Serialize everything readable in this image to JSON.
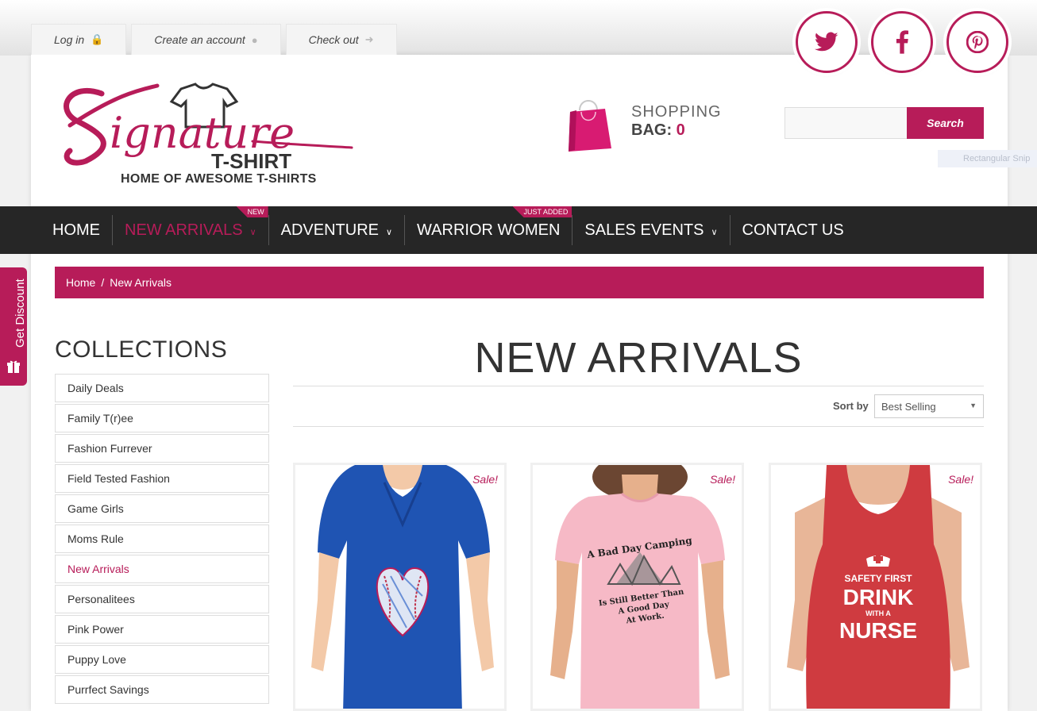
{
  "topbar": {
    "login": "Log in",
    "create_account": "Create an account",
    "checkout": "Check out"
  },
  "social": [
    "twitter-icon",
    "facebook-icon",
    "pinterest-icon"
  ],
  "logo": {
    "script": "Signature",
    "sub": "T-SHIRT",
    "tagline": "HOME OF AWESOME T-SHIRTS"
  },
  "bag": {
    "line1": "SHOPPING",
    "label": "BAG:",
    "count": "0"
  },
  "search": {
    "value": "",
    "button": "Search"
  },
  "overlay_text": "Rectangular Snip",
  "nav": [
    {
      "label": "HOME"
    },
    {
      "label": "NEW ARRIVALS",
      "badge": "NEW",
      "active": true,
      "dropdown": true
    },
    {
      "label": "ADVENTURE",
      "dropdown": true
    },
    {
      "label": "WARRIOR WOMEN",
      "badge": "JUST ADDED"
    },
    {
      "label": "SALES EVENTS",
      "dropdown": true
    },
    {
      "label": "CONTACT US"
    }
  ],
  "breadcrumb": {
    "home": "Home",
    "sep": "/",
    "current": "New Arrivals"
  },
  "discount": "Get Discount",
  "collections": {
    "title": "COLLECTIONS",
    "items": [
      "Daily Deals",
      "Family T(r)ee",
      "Fashion Furrever",
      "Field Tested Fashion",
      "Game Girls",
      "Moms Rule",
      "New Arrivals",
      "Personalitees",
      "Pink Power",
      "Puppy Love",
      "Purrfect Savings"
    ],
    "active_index": 6
  },
  "main": {
    "title": "NEW ARRIVALS",
    "sort_label": "Sort by",
    "sort_value": "Best Selling"
  },
  "products": [
    {
      "sale": "Sale!",
      "color": "#1f54b3",
      "design": "baseball heart"
    },
    {
      "sale": "Sale!",
      "color": "#f6b9c6",
      "line1": "A Bad Day Camping",
      "line2": "Is Still Better Than",
      "line3": "A Good Day",
      "line4": "At Work."
    },
    {
      "sale": "Sale!",
      "color": "#cf3b40",
      "line1": "SAFETY FIRST",
      "line2": "DRINK",
      "line3": "WITH A",
      "line4": "NURSE"
    }
  ],
  "colors": {
    "accent": "#b71c59",
    "nav_bg": "#262626"
  }
}
